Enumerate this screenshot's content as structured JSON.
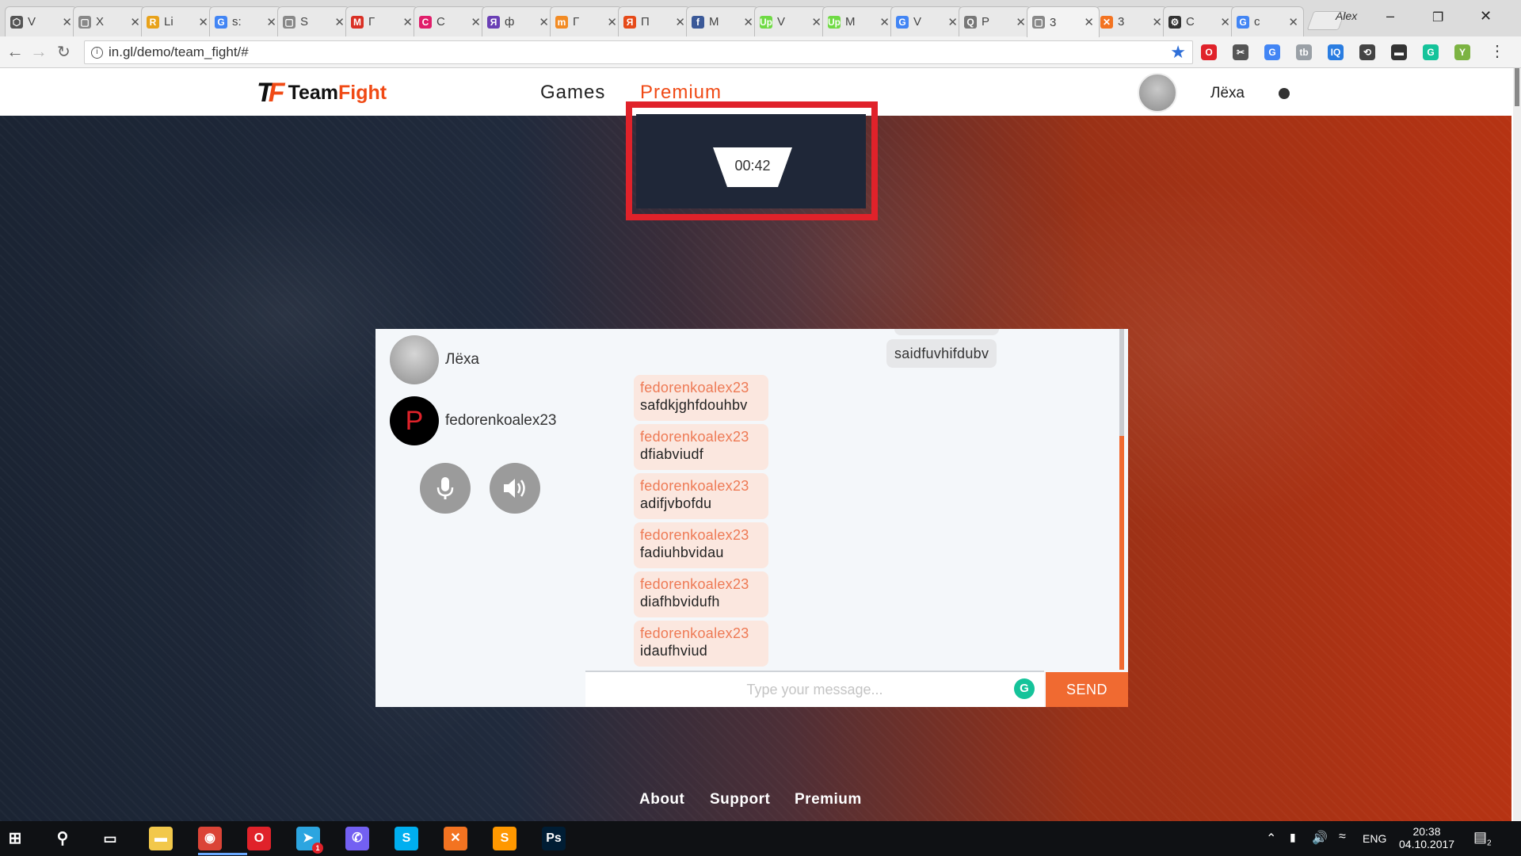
{
  "browser": {
    "tabs": [
      {
        "label": "V",
        "color": "#555555",
        "glyph": "⬡"
      },
      {
        "label": "X",
        "color": "#888888",
        "glyph": "▢"
      },
      {
        "label": "Li",
        "color": "#e8a21a",
        "glyph": "R"
      },
      {
        "label": "s:",
        "color": "#4285f4",
        "glyph": "G"
      },
      {
        "label": "S",
        "color": "#888888",
        "glyph": "▢"
      },
      {
        "label": "Г",
        "color": "#d93025",
        "glyph": "M"
      },
      {
        "label": "C",
        "color": "#e01e6a",
        "glyph": "C"
      },
      {
        "label": "ф",
        "color": "#6a3fb5",
        "glyph": "Я"
      },
      {
        "label": "Г",
        "color": "#f28b24",
        "glyph": "m"
      },
      {
        "label": "П",
        "color": "#e64a19",
        "glyph": "Я"
      },
      {
        "label": "M",
        "color": "#3b5998",
        "glyph": "f"
      },
      {
        "label": "V",
        "color": "#6fda44",
        "glyph": "Up"
      },
      {
        "label": "M",
        "color": "#6fda44",
        "glyph": "Up"
      },
      {
        "label": "V",
        "color": "#4285f4",
        "glyph": "G"
      },
      {
        "label": "P",
        "color": "#777777",
        "glyph": "Q"
      },
      {
        "label": "3",
        "color": "#888888",
        "glyph": "▢",
        "active": true
      },
      {
        "label": "3",
        "color": "#f37321",
        "glyph": "✕"
      },
      {
        "label": "C",
        "color": "#333333",
        "glyph": "⚙"
      },
      {
        "label": "c",
        "color": "#4285f4",
        "glyph": "G"
      }
    ],
    "profile_name": "Alex",
    "url": "in.gl/demo/team_fight/#",
    "extensions": [
      {
        "glyph": "O",
        "color": "#e0222a"
      },
      {
        "glyph": "✂",
        "color": "#555555"
      },
      {
        "glyph": "G",
        "color": "#4285f4"
      },
      {
        "glyph": "tb",
        "color": "#9aa0a6"
      },
      {
        "glyph": "IQ",
        "color": "#2a7de1"
      },
      {
        "glyph": "⟲",
        "color": "#444444"
      },
      {
        "glyph": "▬",
        "color": "#333333"
      },
      {
        "glyph": "G",
        "color": "#15c39a"
      },
      {
        "glyph": "Y",
        "color": "#7cb342"
      }
    ]
  },
  "site": {
    "logo_mark_a": "T",
    "logo_mark_b": "F",
    "logo_word_a": "Team",
    "logo_word_b": "Fight",
    "nav": [
      {
        "label": "Games",
        "color": "#222222"
      },
      {
        "label": "Premium",
        "color": "#f04a15"
      }
    ],
    "username": "Лёха",
    "timer": "00:42",
    "accent": "#f06a31",
    "highlight_color": "#e0222a"
  },
  "chat": {
    "participants": [
      {
        "name": "Лёха",
        "avatar": "photo"
      },
      {
        "name": "fedorenkoalex23",
        "avatar": "P"
      }
    ],
    "outgoing_top": "saidfuvhifdubv",
    "messages": [
      {
        "author": "fedorenkoalex23",
        "text": "safdkjghfdouhbv"
      },
      {
        "author": "fedorenkoalex23",
        "text": "dfiabviudf"
      },
      {
        "author": "fedorenkoalex23",
        "text": "adifjvbofdu"
      },
      {
        "author": "fedorenkoalex23",
        "text": "fadiuhbvidau"
      },
      {
        "author": "fedorenkoalex23",
        "text": "diafhbvidufh"
      },
      {
        "author": "fedorenkoalex23",
        "text": "idaufhviud"
      }
    ],
    "input_placeholder": "Type your message...",
    "send_label": "SEND"
  },
  "footer": {
    "links": [
      "About",
      "Support",
      "Premium"
    ]
  },
  "taskbar": {
    "apps": [
      {
        "name": "file-explorer",
        "glyph": "▬",
        "color": "#f2c84b"
      },
      {
        "name": "chrome",
        "glyph": "◉",
        "color": "#db4437"
      },
      {
        "name": "opera",
        "glyph": "O",
        "color": "#e0222a"
      },
      {
        "name": "telegram",
        "glyph": "➤",
        "color": "#2ca5e0",
        "badge": "1"
      },
      {
        "name": "viber",
        "glyph": "✆",
        "color": "#7360f2"
      },
      {
        "name": "skype",
        "glyph": "S",
        "color": "#00aff0"
      },
      {
        "name": "xampp",
        "glyph": "✕",
        "color": "#f37321"
      },
      {
        "name": "sublime",
        "glyph": "S",
        "color": "#ff9800"
      },
      {
        "name": "photoshop",
        "glyph": "Ps",
        "color": "#001d34"
      }
    ],
    "lang": "ENG",
    "time": "20:38",
    "date": "04.10.2017",
    "notif_count": "2"
  }
}
